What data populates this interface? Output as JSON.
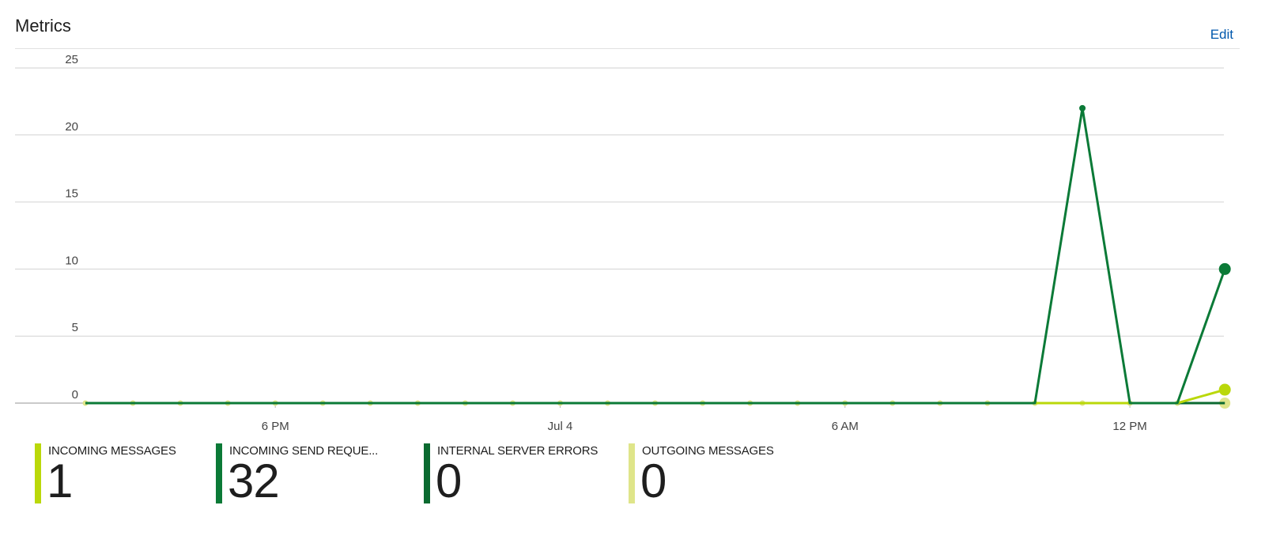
{
  "header": {
    "title": "Metrics",
    "edit_label": "Edit"
  },
  "chart_data": {
    "type": "line",
    "ylim": [
      0,
      25
    ],
    "y_ticks": [
      0,
      5,
      10,
      15,
      20,
      25
    ],
    "x_ticks": [
      "6 PM",
      "Jul 4",
      "6 AM",
      "12 PM"
    ],
    "x_tick_positions": [
      4,
      10,
      16,
      22
    ],
    "grid": true,
    "legend_placement": "bottom-left",
    "series": [
      {
        "name": "INCOMING MESSAGES",
        "color": "#bad80a",
        "values": [
          0,
          0,
          0,
          0,
          0,
          0,
          0,
          0,
          0,
          0,
          0,
          0,
          0,
          0,
          0,
          0,
          0,
          0,
          0,
          0,
          0,
          0,
          0,
          0,
          1
        ],
        "last_marker": true
      },
      {
        "name": "INCOMING SEND REQUE...",
        "color": "#0b7a37",
        "values": [
          0,
          0,
          0,
          0,
          0,
          0,
          0,
          0,
          0,
          0,
          0,
          0,
          0,
          0,
          0,
          0,
          0,
          0,
          0,
          0,
          0,
          22,
          0,
          0,
          10
        ],
        "peak_marker_index": 21,
        "last_marker": true
      },
      {
        "name": "INTERNAL SERVER ERRORS",
        "color": "#0b6a30",
        "values": [
          0,
          0,
          0,
          0,
          0,
          0,
          0,
          0,
          0,
          0,
          0,
          0,
          0,
          0,
          0,
          0,
          0,
          0,
          0,
          0,
          0,
          0,
          0,
          0,
          0
        ]
      },
      {
        "name": "OUTGOING MESSAGES",
        "color": "#dfe58a",
        "values": [
          0,
          0,
          0,
          0,
          0,
          0,
          0,
          0,
          0,
          0,
          0,
          0,
          0,
          0,
          0,
          0,
          0,
          0,
          0,
          0,
          0,
          0,
          0,
          0,
          0
        ],
        "dot_markers": true
      }
    ]
  },
  "legend": [
    {
      "label": "INCOMING MESSAGES",
      "value": "1",
      "color": "#bad80a"
    },
    {
      "label": "INCOMING SEND REQUE...",
      "value": "32",
      "color": "#0b7a37"
    },
    {
      "label": "INTERNAL SERVER ERRORS",
      "value": "0",
      "color": "#0b6a30"
    },
    {
      "label": "OUTGOING MESSAGES",
      "value": "0",
      "color": "#dfe58a"
    }
  ]
}
